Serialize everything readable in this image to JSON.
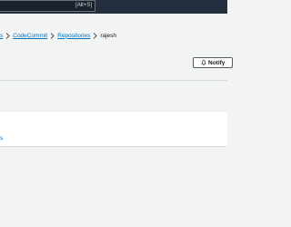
{
  "topbar": {
    "search_shortcut": "[Alt+S]"
  },
  "breadcrumb": {
    "items": [
      {
        "label": "s",
        "link": true
      },
      {
        "label": "CodeCommit",
        "link": true
      },
      {
        "label": "Repositories",
        "link": true
      },
      {
        "label": "rajesh",
        "link": false
      }
    ]
  },
  "header": {
    "notify_label": "Notify"
  },
  "panel": {
    "partial_text": "",
    "partial_link": "s"
  },
  "colors": {
    "topbar": "#232f3e",
    "link": "#0073bb",
    "background": "#f2f3f3"
  }
}
